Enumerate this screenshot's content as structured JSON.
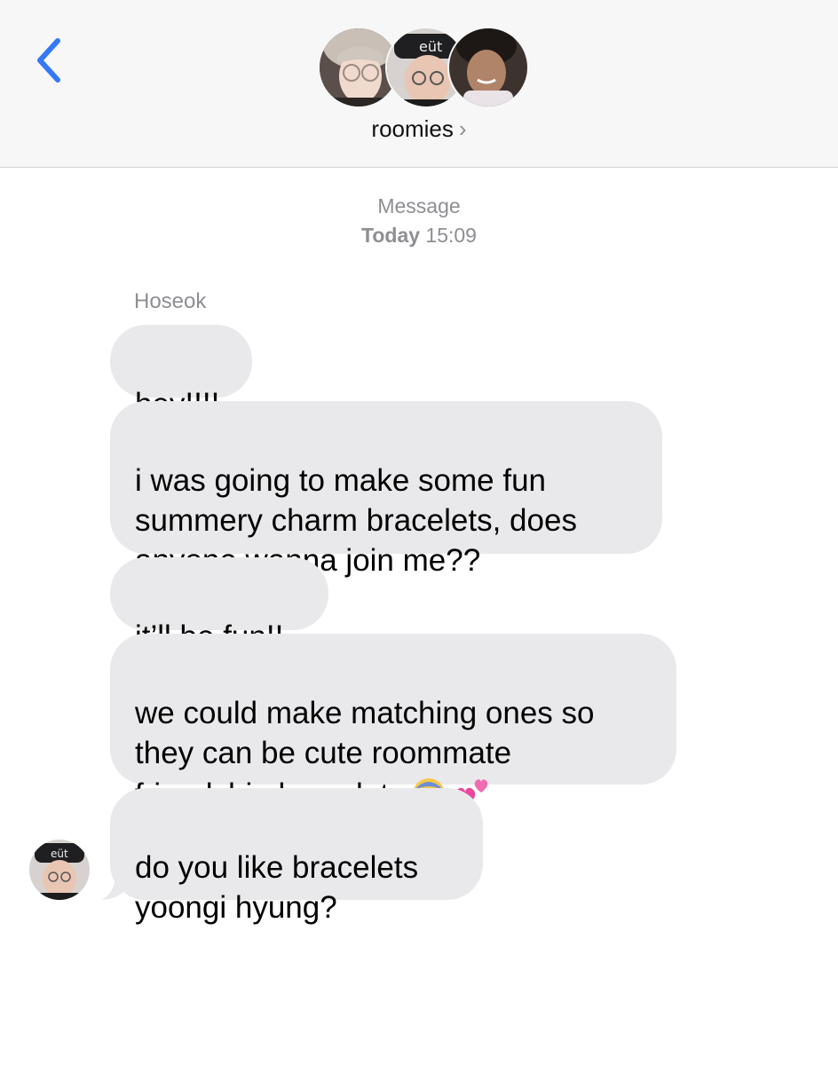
{
  "header": {
    "group_name": "roomies",
    "chevron": "›",
    "back_icon": "chevron-left-icon"
  },
  "meta": {
    "service": "Message",
    "day": "Today",
    "time": "15:09"
  },
  "conversation": {
    "sender_name": "Hoseok",
    "messages": [
      {
        "text": "hey!!!!"
      },
      {
        "text": "i was going to make some fun\nsummery charm bracelets, does\nanyone wanna join me??"
      },
      {
        "text": "it’ll be fun!!"
      },
      {
        "text": "we could make matching ones so\nthey can be cute roommate\nfriendship bracelets",
        "emojis": [
          "face-screaming-emoji",
          "two-hearts-emoji"
        ]
      },
      {
        "text": "do you like bracelets\nyoongi hyung?"
      }
    ]
  },
  "colors": {
    "accent_blue": "#3478f6",
    "bubble_gray": "#e9e9eb",
    "secondary_text": "#8e8e93",
    "header_bg": "#f7f7f7"
  }
}
